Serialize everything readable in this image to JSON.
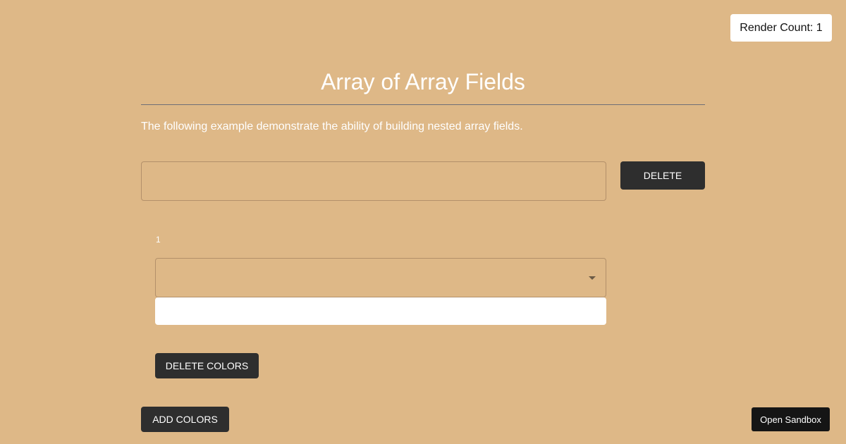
{
  "render_count": {
    "label": "Render Count: 1"
  },
  "header": {
    "title": "Array of Array Fields",
    "description": "The following example demonstrate the ability of building nested array fields."
  },
  "form": {
    "name_input": {
      "value": "",
      "placeholder": ""
    },
    "delete_label": "DELETE",
    "nested": {
      "index_label": "1",
      "select": {
        "selected_value": ""
      },
      "color_input": {
        "value": "",
        "placeholder": ""
      },
      "delete_colors_label": "DELETE COLORS"
    },
    "add_colors_label": "ADD COLORS"
  },
  "footer": {
    "open_sandbox_label": "Open Sandbox"
  },
  "colors": {
    "background": "#deb887",
    "button_dark": "#2e2e2e",
    "sandbox_button": "#151515",
    "divider": "#6e6e77",
    "text_light": "#ffffff"
  }
}
